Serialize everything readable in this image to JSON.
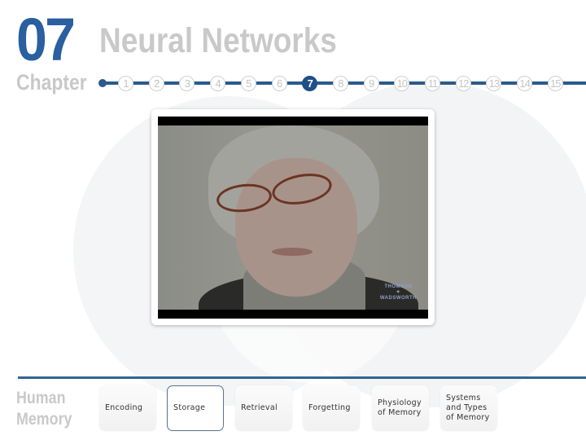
{
  "header": {
    "chapter_number": "07",
    "chapter_label": "Chapter",
    "chapter_title": "Neural Networks"
  },
  "steps": {
    "items": [
      "1",
      "2",
      "3",
      "4",
      "5",
      "6",
      "7",
      "8",
      "9",
      "10",
      "11",
      "12",
      "13",
      "14",
      "15"
    ],
    "active": "7"
  },
  "video": {
    "watermark_line1": "THOMSON",
    "watermark_line2": "✦",
    "watermark_line3": "WADSWORTH"
  },
  "footer": {
    "section_label_line1": "Human",
    "section_label_line2": "Memory",
    "tabs": [
      {
        "label": "Encoding",
        "selected": false
      },
      {
        "label": "Storage",
        "selected": true
      },
      {
        "label": "Retrieval",
        "selected": false
      },
      {
        "label": "Forgetting",
        "selected": false
      },
      {
        "label": "Physiology\nof Memory",
        "selected": false
      },
      {
        "label": "Systems\nand Types\nof Memory",
        "selected": false
      }
    ]
  },
  "colors": {
    "accent": "#2a5fa0",
    "track": "#2a5a8e",
    "muted_text": "#c9c9c9"
  }
}
